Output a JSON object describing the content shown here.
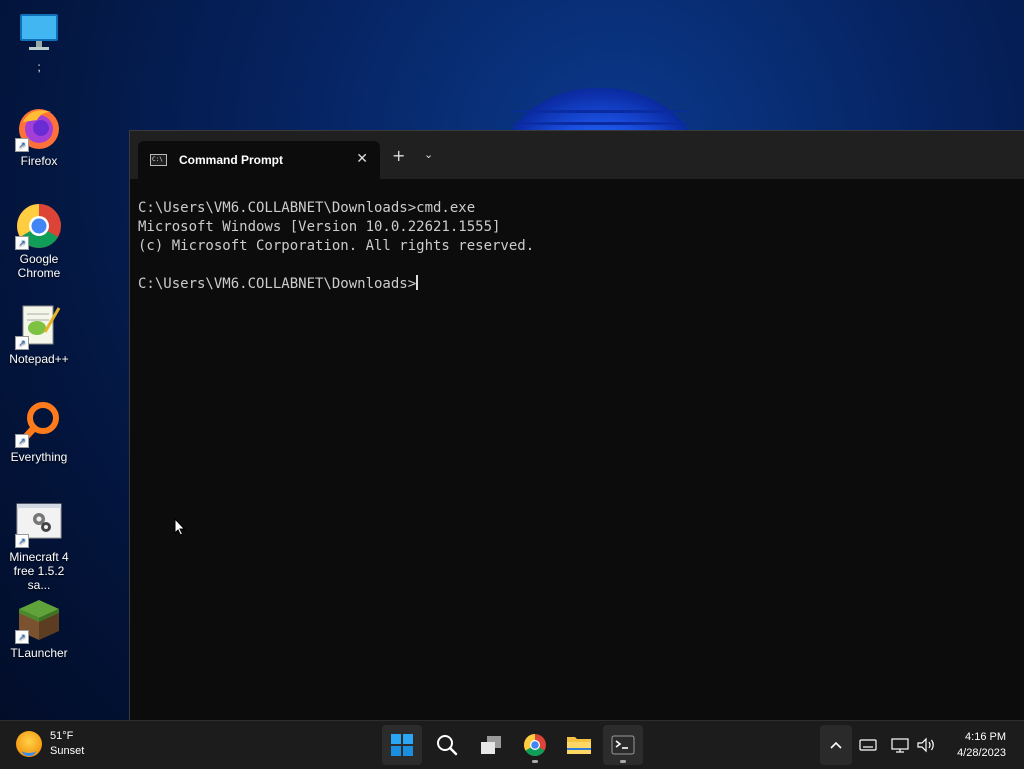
{
  "desktop": {
    "icons": [
      {
        "label": ";",
        "icon": "monitor-icon"
      },
      {
        "label": "Firefox",
        "icon": "firefox-icon"
      },
      {
        "label": "Google Chrome",
        "icon": "chrome-icon"
      },
      {
        "label": "Notepad++",
        "icon": "notepadpp-icon"
      },
      {
        "label": "Everything",
        "icon": "everything-icon"
      },
      {
        "label": "Minecraft 4 free 1.5.2 sa...",
        "icon": "settings-file-icon"
      },
      {
        "label": "TLauncher",
        "icon": "grass-block-icon"
      }
    ]
  },
  "terminal": {
    "tab_title": "Command Prompt",
    "tab_close": "✕",
    "new_tab": "+",
    "dropdown": "⌄",
    "lines": [
      "C:\\Users\\VM6.COLLABNET\\Downloads>cmd.exe",
      "Microsoft Windows [Version 10.0.22621.1555]",
      "(c) Microsoft Corporation. All rights reserved.",
      "",
      "C:\\Users\\VM6.COLLABNET\\Downloads>"
    ],
    "colors": {
      "background": "#0c0c0c",
      "text": "#cccccc",
      "tabbar": "#202020"
    }
  },
  "taskbar": {
    "weather": {
      "temp": "51°F",
      "condition": "Sunset"
    },
    "apps": [
      "start-icon",
      "search-icon",
      "task-view-icon",
      "chrome-icon",
      "file-explorer-icon",
      "terminal-icon"
    ],
    "tray_icons": [
      "chevron-up-icon",
      "keyboard-icon",
      "network-icon",
      "volume-icon"
    ],
    "clock": {
      "time": "4:16 PM",
      "date": "4/28/2023"
    }
  }
}
